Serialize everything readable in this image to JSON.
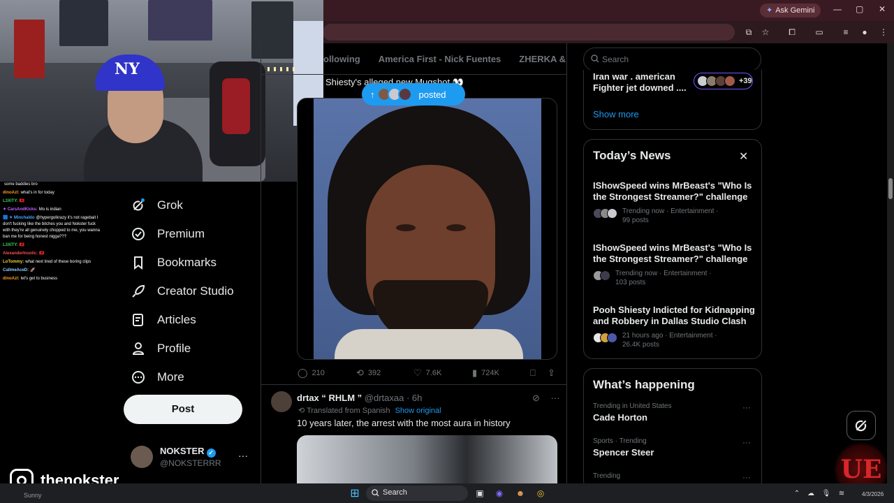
{
  "browser": {
    "gemini_label": "Ask Gemini",
    "window_controls": [
      "—",
      "▢",
      "✕"
    ]
  },
  "chat": [
    {
      "user": "",
      "user_color": "#ffffff",
      "text": "some baddies bro"
    },
    {
      "user": "dinoAzl:",
      "user_color": "#ff9f1a",
      "text": "what's in for today"
    },
    {
      "user": "L3XITY:",
      "user_color": "#3ad15c",
      "text": "🇦🇱"
    },
    {
      "user": "✦ CarsAndKicks:",
      "user_color": "#c061ff",
      "text": "Mo is indian"
    },
    {
      "user": "🟦 ✦ Minchaldo",
      "user_color": "#4aa3ff",
      "text": "@hypergolkrazy it's not ragebait I don't fucking like the bitches you and Nokster fuck with they're all genuinely chopped to me, you wanna ban me for being honest nigga???"
    },
    {
      "user": "L3XITY:",
      "user_color": "#3ad15c",
      "text": "🇦🇱"
    },
    {
      "user": "AlexanderInsolic:",
      "user_color": "#ff4d4d",
      "text": "🇦🇱"
    },
    {
      "user": "LoTommy:",
      "user_color": "#f2d33a",
      "text": "what next tired of these boring clips"
    },
    {
      "user": "CallmeAceD:",
      "user_color": "#8fd0ff",
      "text": "🚀"
    },
    {
      "user": "dinoAzl:",
      "user_color": "#ff9f1a",
      "text": "let's get to business"
    }
  ],
  "nav": {
    "items": [
      {
        "label": "Grok",
        "icon": "grok-icon"
      },
      {
        "label": "Premium",
        "icon": "premium-icon"
      },
      {
        "label": "Bookmarks",
        "icon": "bookmark-icon"
      },
      {
        "label": "Creator Studio",
        "icon": "rocket-icon"
      },
      {
        "label": "Articles",
        "icon": "articles-icon"
      },
      {
        "label": "Profile",
        "icon": "profile-icon"
      },
      {
        "label": "More",
        "icon": "more-icon"
      }
    ],
    "post_label": "Post"
  },
  "account": {
    "name": "NOKSTER",
    "handle": "@NOKSTERRR",
    "more": "···"
  },
  "instagram": {
    "handle": "thenokster"
  },
  "tabs": [
    "ollowing",
    "America First - Nick Fuentes",
    "ZHERKA & CRI"
  ],
  "tweet1": {
    "text": "Shiesty's alleged new Mugshot 👀",
    "new_posts_label": "posted",
    "replies": "210",
    "reposts": "392",
    "likes": "7.6K",
    "views": "724K"
  },
  "tweet2": {
    "name": "drtax “ RHLM ”",
    "handle": "@drtaxaa",
    "time": "· 6h",
    "translated": "Translated from Spanish",
    "show_original": "Show original",
    "text": "10 years later, the arrest with the most aura in history"
  },
  "search": {
    "placeholder": "Search"
  },
  "trending_card": {
    "title": "Iran war . american Fighter jet downed ....",
    "count": "+39",
    "show_more": "Show more"
  },
  "news": {
    "title": "Today’s News",
    "items": [
      {
        "title": "IShowSpeed wins MrBeast's \"Who Is the Strongest Streamer?\" challenge",
        "meta": "Trending now · Entertainment · 99 posts"
      },
      {
        "title": "IShowSpeed wins MrBeast's \"Who Is the Strongest Streamer?\" challenge",
        "meta": "Trending now · Entertainment · 103 posts"
      },
      {
        "title": "Pooh Shiesty Indicted for Kidnapping and Robbery in Dallas Studio Clash",
        "meta": "21 hours ago · Entertainment · 26.4K posts"
      }
    ]
  },
  "happening": {
    "title": "What’s happening",
    "items": [
      {
        "context": "Trending in United States",
        "name": "Cade Horton"
      },
      {
        "context": "Sports · Trending",
        "name": "Spencer Steer"
      },
      {
        "context": "Trending",
        "name": ""
      }
    ]
  },
  "taskbar": {
    "search_label": "Search",
    "left_text": "Sunny",
    "date": "4/3/2026"
  },
  "colors": {
    "accent": "#1d9bf0",
    "background": "#000000",
    "border": "#2f3336",
    "muted": "#71767b"
  }
}
